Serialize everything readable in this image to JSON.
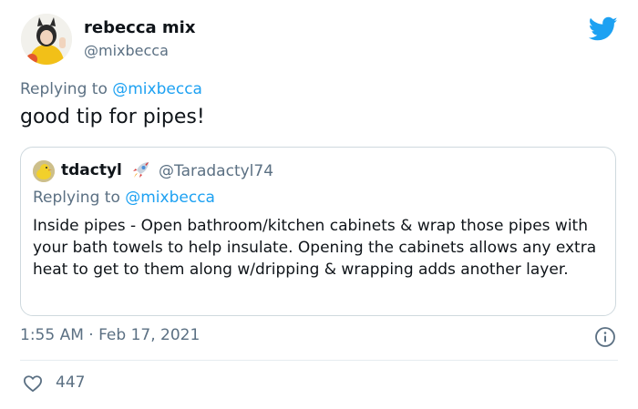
{
  "tweet": {
    "author_name": "rebecca mix",
    "author_handle": "@mixbecca",
    "reply_prefix": "Replying to ",
    "reply_to": "@mixbecca",
    "text": "good tip for pipes!",
    "timestamp": "1:55 AM · Feb 17, 2021",
    "like_count": "447"
  },
  "quoted_tweet": {
    "author_name": "tdactyl",
    "author_handle": "@Taradactyl74",
    "reply_prefix": "Replying to ",
    "reply_to": "@mixbecca",
    "text": "Inside pipes - Open bathroom/kitchen cabinets & wrap those pipes with your bath towels to help insulate. Opening the cabinets allows any extra heat to get to them along w/dripping & wrapping adds another layer."
  },
  "icons": {
    "brand": "twitter-bird-icon",
    "info": "info-icon",
    "like": "heart-icon",
    "emoji": "rocket-icon"
  },
  "colors": {
    "brand_blue": "#1da1f2",
    "text_primary": "#0f1419",
    "text_secondary": "#5b7083",
    "border": "#cfd9de"
  }
}
